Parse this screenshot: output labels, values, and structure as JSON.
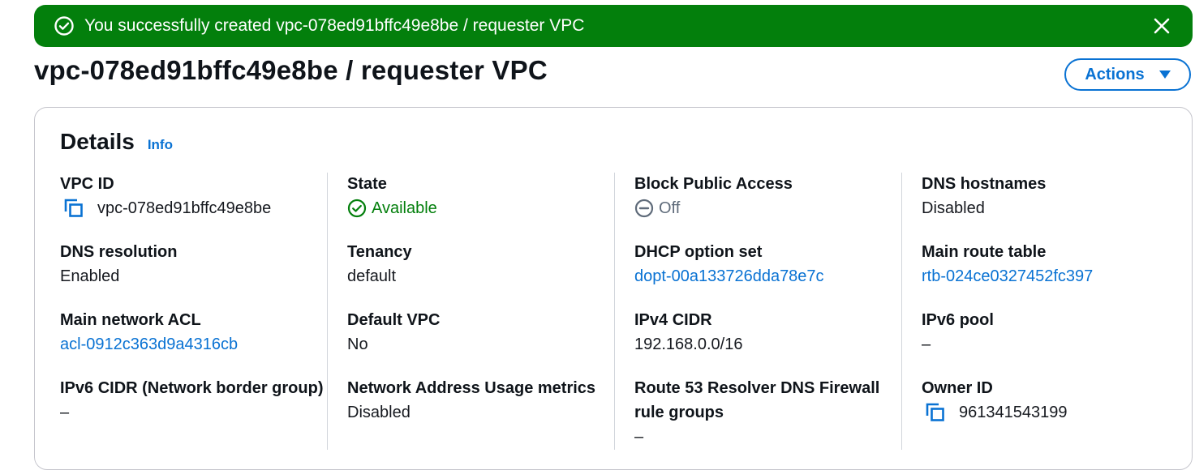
{
  "flash": {
    "message": "You successfully created vpc-078ed91bffc49e8be / requester VPC",
    "color": "#037f0c"
  },
  "page": {
    "title": "vpc-078ed91bffc49e8be / requester VPC",
    "actions_label": "Actions"
  },
  "details": {
    "title": "Details",
    "info_label": "Info",
    "columns": [
      [
        {
          "label": "VPC ID",
          "value": "vpc-078ed91bffc49e8be"
        },
        {
          "label": "DNS resolution",
          "value": "Enabled"
        },
        {
          "label": "Main network ACL",
          "value": "acl-0912c363d9a4316cb"
        },
        {
          "label": "IPv6 CIDR (Network border group)",
          "value": "–"
        }
      ],
      [
        {
          "label": "State",
          "value": "Available"
        },
        {
          "label": "Tenancy",
          "value": "default"
        },
        {
          "label": "Default VPC",
          "value": "No"
        },
        {
          "label": "Network Address Usage metrics",
          "value": "Disabled"
        }
      ],
      [
        {
          "label": "Block Public Access",
          "value": "Off"
        },
        {
          "label": "DHCP option set",
          "value": "dopt-00a133726dda78e7c"
        },
        {
          "label": "IPv4 CIDR",
          "value": "192.168.0.0/16"
        },
        {
          "label": "Route 53 Resolver DNS Firewall rule groups",
          "value": "–"
        }
      ],
      [
        {
          "label": "DNS hostnames",
          "value": "Disabled"
        },
        {
          "label": "Main route table",
          "value": "rtb-024ce0327452fc397"
        },
        {
          "label": "IPv6 pool",
          "value": "–"
        },
        {
          "label": "Owner ID",
          "value": "961341543199"
        }
      ]
    ]
  },
  "colors": {
    "link": "#0972d3",
    "success": "#037f0c",
    "muted": "#5f6b7a"
  }
}
